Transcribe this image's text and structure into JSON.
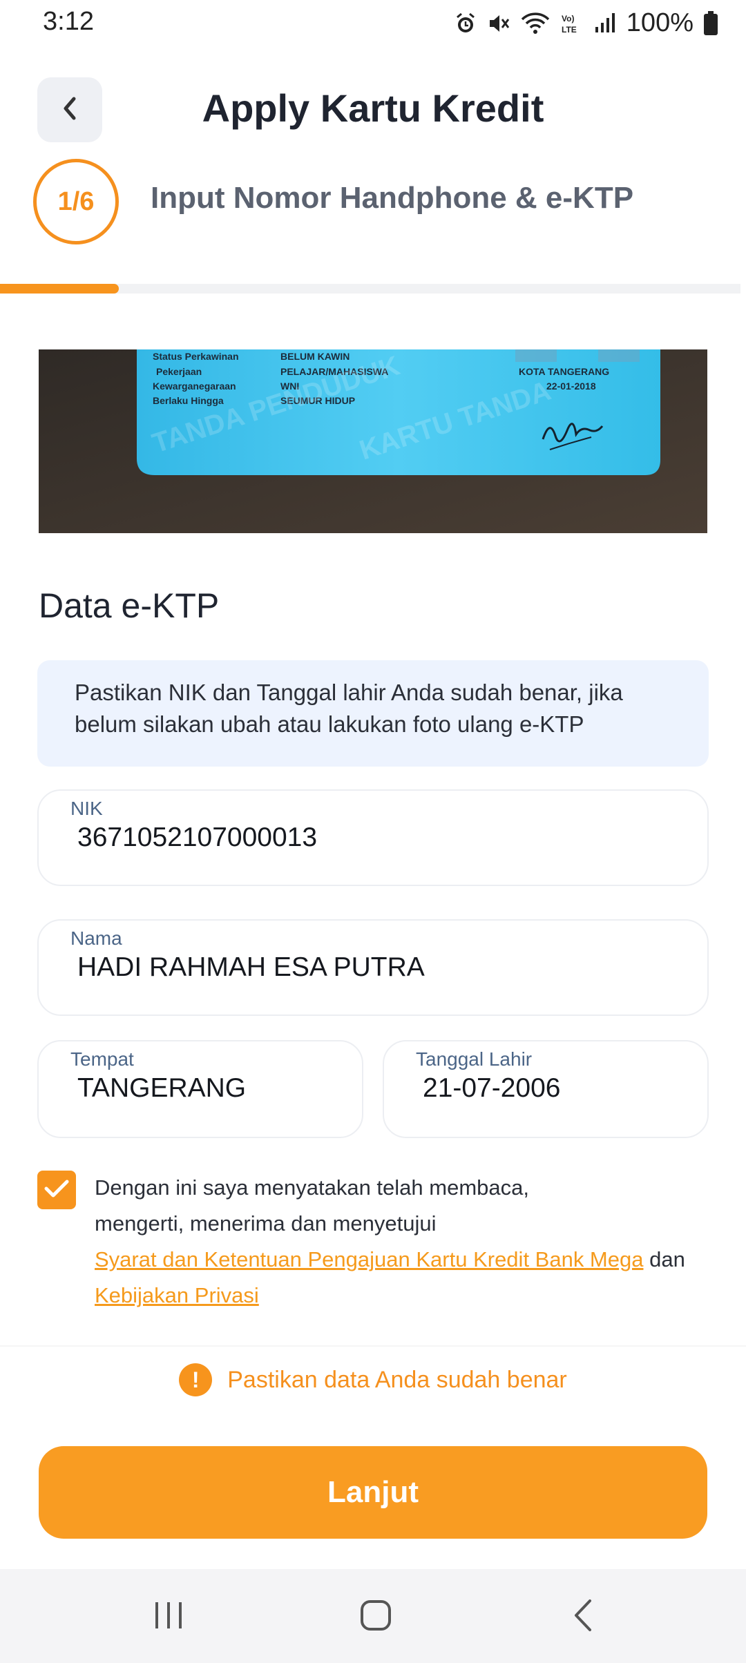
{
  "status_bar": {
    "time": "3:12",
    "battery": "100%",
    "icons": [
      "alarm-icon",
      "mute-icon",
      "wifi-icon",
      "volte-icon",
      "signal-icon",
      "battery-icon"
    ]
  },
  "header": {
    "back_icon": "chevron-left-icon",
    "title": "Apply Kartu Kredit"
  },
  "step": {
    "indicator": "1/6",
    "label": "Input Nomor Handphone & e-KTP",
    "progress": 0.16
  },
  "photo": {
    "subject": "e-KTP card photo",
    "card_text": {
      "row1_label": "Status Perkawinan",
      "row1_value": "BELUM KAWIN",
      "row2_label": "Pekerjaan",
      "row2_value": "PELAJAR/MAHASISWA",
      "row3_label": "Kewarganegaraan",
      "row3_value": "WNI",
      "row4_label": "Berlaku Hingga",
      "row4_value": "SEUMUR HIDUP",
      "city": "KOTA TANGERANG",
      "date": "22-01-2018"
    }
  },
  "section": {
    "title": "Data e-KTP",
    "info": "Pastikan NIK dan Tanggal lahir Anda sudah benar, jika belum silakan ubah atau lakukan foto ulang e-KTP"
  },
  "fields": {
    "nik": {
      "label": "NIK",
      "value": "3671052107000013"
    },
    "nama": {
      "label": "Nama",
      "value": "HADI RAHMAH ESA PUTRA"
    },
    "tempat": {
      "label": "Tempat",
      "value": "TANGERANG"
    },
    "tanggal_lahir": {
      "label": "Tanggal Lahir",
      "value": "21-07-2006"
    }
  },
  "consent": {
    "checked": true,
    "text_1": "Dengan ini saya menyatakan telah membaca,",
    "text_2": "mengerti, menerima dan menyetujui",
    "link_terms": "Syarat dan Ketentuan Pengajuan Kartu Kredit Bank Mega",
    "conjunction": "dan",
    "link_privacy": "Kebijakan Privasi"
  },
  "warning": {
    "icon": "exclamation-icon",
    "text": "Pastikan data Anda sudah benar"
  },
  "cta": {
    "label": "Lanjut"
  },
  "colors": {
    "accent": "#f7941d",
    "info_bg": "#edf3fe",
    "label_blue": "#4b6587"
  },
  "nav_bar": {
    "icons": [
      "recents-icon",
      "home-icon",
      "back-icon"
    ]
  }
}
